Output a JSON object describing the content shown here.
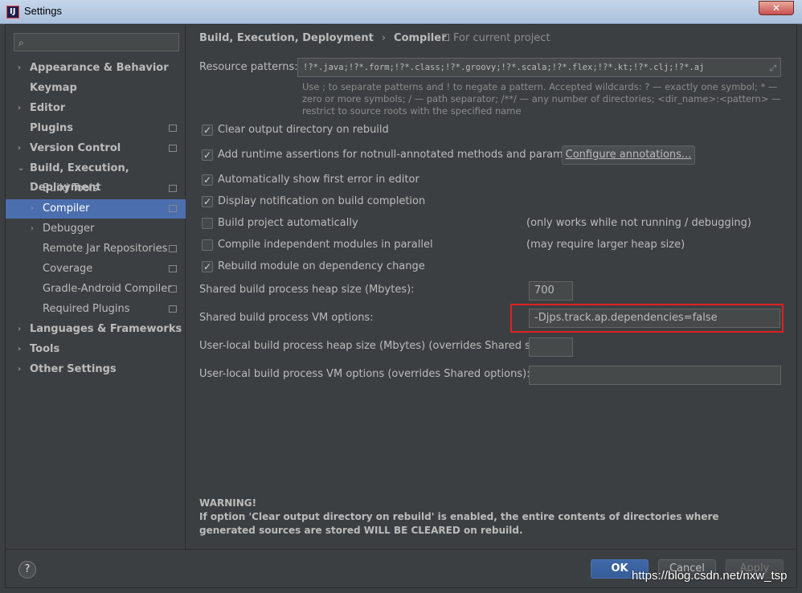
{
  "window": {
    "title": "Settings",
    "close_label": "✕"
  },
  "sidebar": {
    "search_placeholder": "",
    "items": [
      {
        "label": "Appearance & Behavior",
        "arrow": "›",
        "bold": true,
        "copy": false
      },
      {
        "label": "Keymap",
        "arrow": "",
        "bold": true,
        "copy": false
      },
      {
        "label": "Editor",
        "arrow": "›",
        "bold": true,
        "copy": false
      },
      {
        "label": "Plugins",
        "arrow": "",
        "bold": true,
        "copy": true
      },
      {
        "label": "Version Control",
        "arrow": "›",
        "bold": true,
        "copy": true
      },
      {
        "label": "Build, Execution, Deployment",
        "arrow": "⌄",
        "bold": true,
        "copy": false
      },
      {
        "label": "Build Tools",
        "arrow": "›",
        "bold": false,
        "copy": true
      },
      {
        "label": "Compiler",
        "arrow": "›",
        "bold": false,
        "copy": true,
        "selected": true
      },
      {
        "label": "Debugger",
        "arrow": "›",
        "bold": false,
        "copy": false
      },
      {
        "label": "Remote Jar Repositories",
        "arrow": "",
        "bold": false,
        "copy": true
      },
      {
        "label": "Coverage",
        "arrow": "",
        "bold": false,
        "copy": true
      },
      {
        "label": "Gradle-Android Compiler",
        "arrow": "",
        "bold": false,
        "copy": true
      },
      {
        "label": "Required Plugins",
        "arrow": "",
        "bold": false,
        "copy": true
      },
      {
        "label": "Languages & Frameworks",
        "arrow": "›",
        "bold": true,
        "copy": false
      },
      {
        "label": "Tools",
        "arrow": "›",
        "bold": true,
        "copy": false
      },
      {
        "label": "Other Settings",
        "arrow": "›",
        "bold": true,
        "copy": false
      }
    ]
  },
  "breadcrumb": {
    "parent": "Build, Execution, Deployment",
    "separator": "›",
    "current": "Compiler",
    "scope": "For current project"
  },
  "resource_patterns": {
    "label": "Resource patterns:",
    "value": "!?*.java;!?*.form;!?*.class;!?*.groovy;!?*.scala;!?*.flex;!?*.kt;!?*.clj;!?*.aj",
    "expand_icon": "⤢",
    "hint": "Use ; to separate patterns and ! to negate a pattern. Accepted wildcards: ? — exactly one symbol; * — zero or more symbols; / — path separator; /**/ — any number of directories; <dir_name>:<pattern> — restrict to source roots with the specified name"
  },
  "options": [
    {
      "label": "Clear output directory on rebuild",
      "checked": true,
      "note": ""
    },
    {
      "label": "Add runtime assertions for notnull-annotated methods and parameters",
      "checked": true,
      "note": ""
    },
    {
      "label": "Automatically show first error in editor",
      "checked": true,
      "note": ""
    },
    {
      "label": "Display notification on build completion",
      "checked": true,
      "note": ""
    },
    {
      "label": "Build project automatically",
      "checked": false,
      "note": "(only works while not running / debugging)"
    },
    {
      "label": "Compile independent modules in parallel",
      "checked": false,
      "note": "(may require larger heap size)"
    },
    {
      "label": "Rebuild module on dependency change",
      "checked": true,
      "note": ""
    }
  ],
  "configure_annotations_label": "Configure annotations...",
  "fields": {
    "heap_label": "Shared build process heap size (Mbytes):",
    "heap_value": "700",
    "vm_label": "Shared build process VM options:",
    "vm_value": "-Djps.track.ap.dependencies=false",
    "user_heap_label": "User-local build process heap size (Mbytes) (overrides Shared size):",
    "user_heap_value": "",
    "user_vm_label": "User-local build process VM options (overrides Shared options):",
    "user_vm_value": ""
  },
  "warning": {
    "title": "WARNING!",
    "text": "If option 'Clear output directory on rebuild' is enabled, the entire contents of directories where generated sources are stored WILL BE CLEARED on rebuild."
  },
  "footer": {
    "help": "?",
    "ok": "OK",
    "cancel": "Cancel",
    "apply": "Apply"
  },
  "watermark": "https://blog.csdn.net/nxw_tsp",
  "colors": {
    "accent": "#4b6eaf",
    "highlight": "#e02020",
    "background": "#3c3f41"
  }
}
